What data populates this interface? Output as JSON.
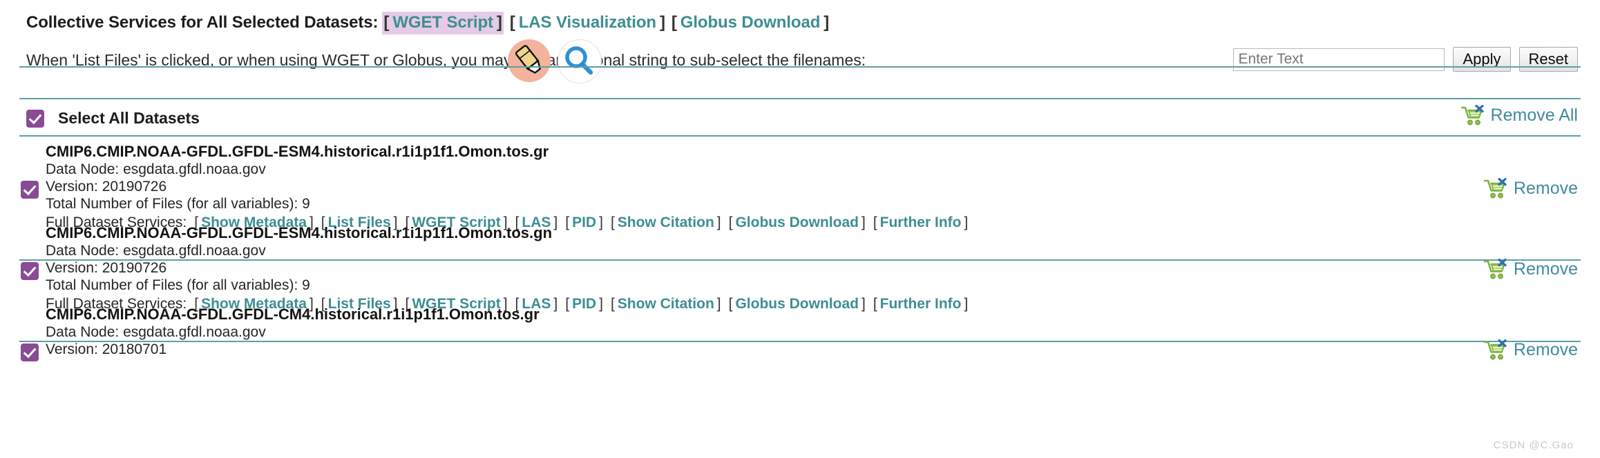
{
  "header": {
    "collective_label": "Collective Services for All Selected Datasets:",
    "services": [
      {
        "label": "WGET Script",
        "highlighted": true
      },
      {
        "label": "LAS Visualization",
        "highlighted": false
      },
      {
        "label": "Globus Download",
        "highlighted": false
      }
    ],
    "hint_text": "When 'List Files' is clicked, or when using WGET or Globus, you may add an optional string to sub-select the filenames:"
  },
  "filter": {
    "placeholder": "Enter Text",
    "value": "",
    "apply_label": "Apply",
    "reset_label": "Reset"
  },
  "select_all": {
    "label": "Select All Datasets",
    "checked": true,
    "remove_all_label": "Remove All"
  },
  "service_links_full": [
    "Show Metadata",
    "List Files",
    "WGET Script",
    "LAS",
    "PID",
    "Show Citation",
    "Globus Download",
    "Further Info"
  ],
  "remove_label": "Remove",
  "datasets": [
    {
      "title": "CMIP6.CMIP.NOAA-GFDL.GFDL-ESM4.historical.r1i1p1f1.Omon.tos.gr",
      "data_node": "Data Node: esgdata.gfdl.noaa.gov",
      "version": "Version: 20190726",
      "files": "Total Number of Files (for all variables): 9",
      "services_label": "Full Dataset Services:",
      "checked": true,
      "show_services": true
    },
    {
      "title": "CMIP6.CMIP.NOAA-GFDL.GFDL-ESM4.historical.r1i1p1f1.Omon.tos.gn",
      "data_node": "Data Node: esgdata.gfdl.noaa.gov",
      "version": "Version: 20190726",
      "files": "Total Number of Files (for all variables): 9",
      "services_label": "Full Dataset Services:",
      "checked": true,
      "show_services": true
    },
    {
      "title": "CMIP6.CMIP.NOAA-GFDL.GFDL-CM4.historical.r1i1p1f1.Omon.tos.gr",
      "data_node": "Data Node: esgdata.gfdl.noaa.gov",
      "version": "Version: 20180701",
      "files": "",
      "services_label": "",
      "checked": true,
      "show_services": false
    }
  ],
  "colors": {
    "link_teal": "#3d8e92",
    "remove_teal": "#3f8ba0",
    "checkbox_purple": "#8a4b96",
    "highlight_pink": "#e5cbe5",
    "rule_teal": "#5e9fa3"
  },
  "cursor": {
    "icon": "highlighter-marker-icon",
    "magnifier_icon": "magnifying-glass-icon"
  },
  "watermark": "CSDN @C.Gao"
}
